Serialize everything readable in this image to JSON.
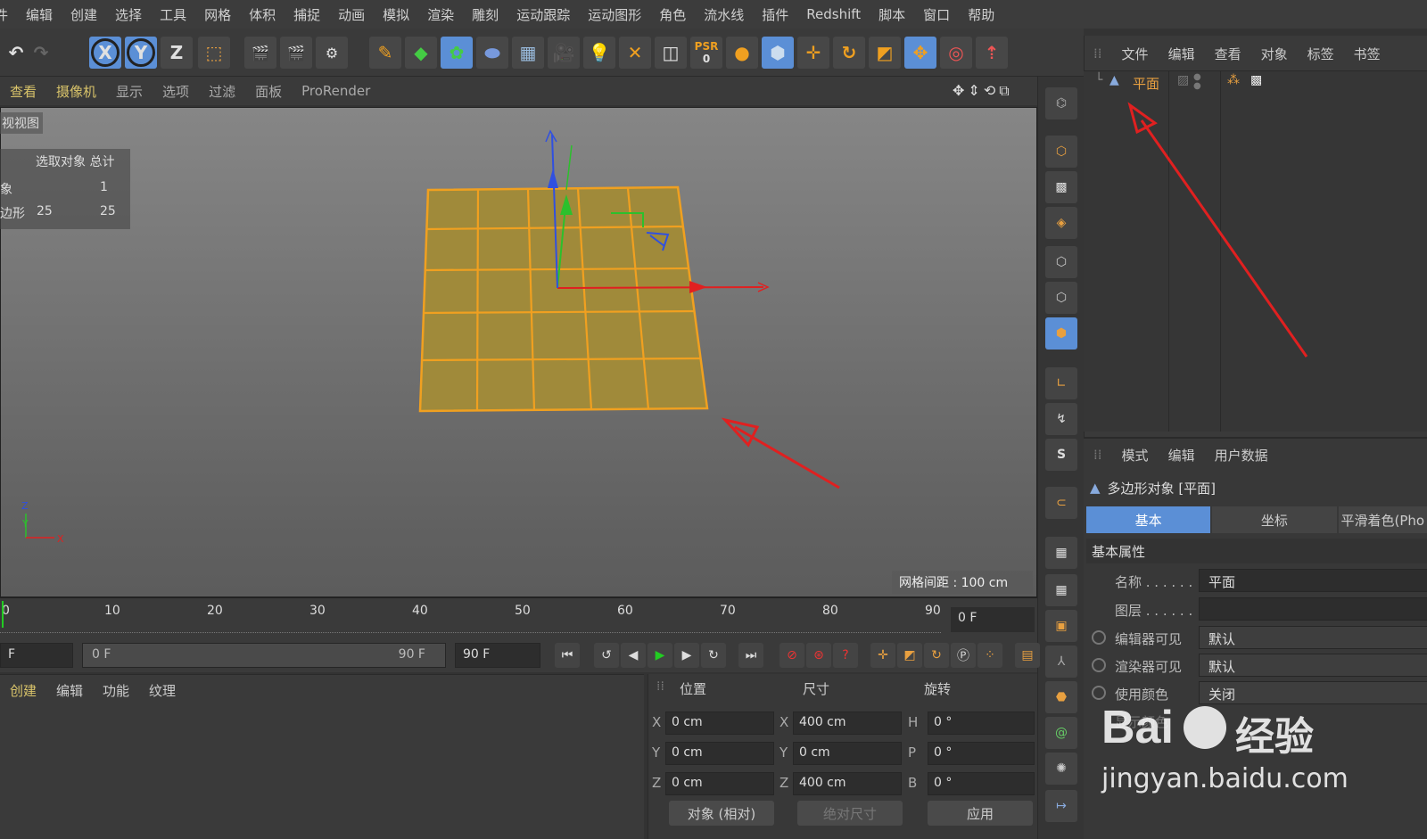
{
  "menu": [
    "件",
    "编辑",
    "创建",
    "选择",
    "工具",
    "网格",
    "体积",
    "捕捉",
    "动画",
    "模拟",
    "渲染",
    "雕刻",
    "运动跟踪",
    "运动图形",
    "角色",
    "流水线",
    "插件",
    "Redshift",
    "脚本",
    "窗口",
    "帮助"
  ],
  "toolbar": {
    "x": "X",
    "y": "Y",
    "z": "Z",
    "psr": "PSR",
    "psr_num": "0"
  },
  "viewport_menu": [
    "查看",
    "摄像机",
    "显示",
    "选项",
    "过滤",
    "面板",
    "ProRender"
  ],
  "viewport": {
    "label": "视视图",
    "stats_header": "选取对象 总计",
    "stats_rows": [
      {
        "label": "象",
        "sel": "",
        "total": "1"
      },
      {
        "label": "边形",
        "sel": "25",
        "total": "25"
      }
    ],
    "grid_spacing": "网格间距 : 100 cm"
  },
  "object_manager": {
    "tabs": [
      "文件",
      "编辑",
      "查看",
      "对象",
      "标签",
      "书签"
    ],
    "object_name": "平面"
  },
  "attributes": {
    "tabs": [
      "模式",
      "编辑",
      "用户数据"
    ],
    "title": "多边形对象 [平面]",
    "subtabs": [
      "基本",
      "坐标",
      "平滑着色(Pho"
    ],
    "section": "基本属性",
    "rows": [
      {
        "label": "名称 . . . . . .",
        "value": "平面"
      },
      {
        "label": "图层 . . . . . .",
        "value": ""
      },
      {
        "label": "编辑器可见",
        "value": "默认"
      },
      {
        "label": "渲染器可见",
        "value": "默认"
      },
      {
        "label": "使用颜色",
        "value": "关闭"
      },
      {
        "label": "显示颜色",
        "value": ""
      }
    ]
  },
  "timeline": {
    "ticks": [
      "0",
      "10",
      "20",
      "30",
      "40",
      "50",
      "60",
      "70",
      "80",
      "90"
    ],
    "current_frame": "0 F",
    "start": "F",
    "range_start": "0 F",
    "range_end": "90 F",
    "end": "90 F"
  },
  "materials": {
    "tabs": [
      "创建",
      "编辑",
      "功能",
      "纹理"
    ]
  },
  "coordinates": {
    "headers": [
      "位置",
      "尺寸",
      "旋转"
    ],
    "position": [
      "0 cm",
      "0 cm",
      "0 cm"
    ],
    "size": [
      "400 cm",
      "0 cm",
      "400 cm"
    ],
    "rotation": [
      "0 °",
      "0 °",
      "0 °"
    ],
    "pos_axes": [
      "X",
      "Y",
      "Z"
    ],
    "size_axes": [
      "X",
      "Y",
      "Z"
    ],
    "rot_axes": [
      "H",
      "P",
      "B"
    ],
    "mode": "对象 (相对)",
    "size_mode": "绝对尺寸",
    "apply": "应用"
  },
  "watermark": {
    "brand": "Bai",
    "brand2": "经验",
    "url": "jingyan.baidu.com"
  },
  "colors": {
    "accent": "#5b8fd6",
    "plane": "#a08a3a",
    "edge": "#f0a020",
    "arrow": "#e02020"
  }
}
